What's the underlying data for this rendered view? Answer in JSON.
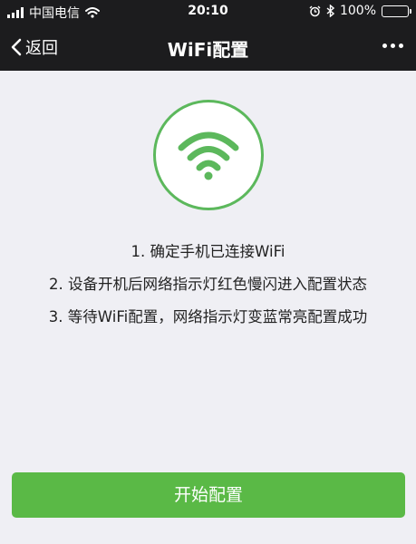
{
  "status_bar": {
    "carrier": "中国电信",
    "time": "20:10",
    "battery": "100%",
    "battery_level": 1.0
  },
  "nav": {
    "back_label": "返回",
    "title": "WiFi配置"
  },
  "instructions": [
    "1. 确定手机已连接WiFi",
    "2. 设备开机后网络指示灯红色慢闪进入配置状态",
    "3. 等待WiFi配置，网络指示灯变蓝常亮配置成功"
  ],
  "start_button": "开始配置",
  "colors": {
    "accent": "#5ab946",
    "bar_background": "#1c1c1e",
    "page_background": "#efeff4"
  },
  "icons": [
    "signal-icon",
    "wifi-status-icon",
    "alarm-icon",
    "bluetooth-icon",
    "battery-icon",
    "back-chevron-icon",
    "more-icon",
    "wifi-icon"
  ]
}
